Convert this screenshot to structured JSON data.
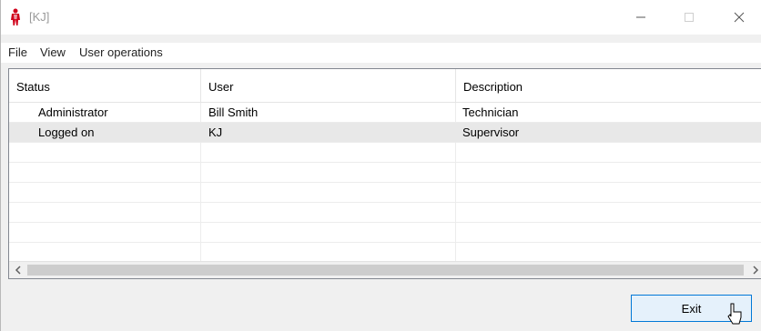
{
  "window": {
    "title": "[KJ]",
    "icon": "person-icon",
    "controls": [
      "minimize-icon",
      "maximize-icon",
      "close-icon"
    ]
  },
  "menu": {
    "items": [
      "File",
      "View",
      "User operations"
    ]
  },
  "table": {
    "columns": [
      "Status",
      "User",
      "Description"
    ],
    "rows": [
      {
        "status": "Administrator",
        "user": "Bill Smith",
        "description": "Technician",
        "selected": false
      },
      {
        "status": "Logged on",
        "user": "KJ",
        "description": "Supervisor",
        "selected": true
      }
    ]
  },
  "footer": {
    "exit_label": "Exit"
  },
  "colors": {
    "accent": "#0078d7",
    "icon_red": "#d0021b"
  }
}
